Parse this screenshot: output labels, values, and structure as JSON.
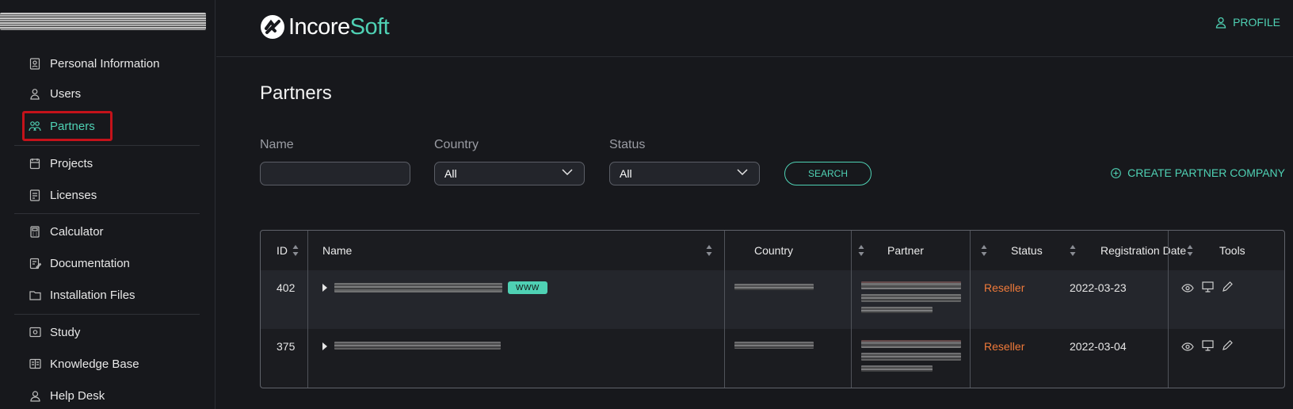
{
  "sidebar": {
    "items": [
      {
        "label": "Personal Information",
        "icon": "id-card-icon"
      },
      {
        "label": "Users",
        "icon": "user-icon"
      },
      {
        "label": "Partners",
        "icon": "partners-icon",
        "active": true
      },
      {
        "label": "Projects",
        "icon": "projects-icon"
      },
      {
        "label": "Licenses",
        "icon": "license-icon"
      },
      {
        "label": "Calculator",
        "icon": "calculator-icon"
      },
      {
        "label": "Documentation",
        "icon": "document-edit-icon"
      },
      {
        "label": "Installation Files",
        "icon": "folder-icon"
      },
      {
        "label": "Study",
        "icon": "study-icon"
      },
      {
        "label": "Knowledge Base",
        "icon": "book-icon"
      },
      {
        "label": "Help Desk",
        "icon": "help-desk-icon"
      }
    ]
  },
  "header": {
    "logo_part1": "Incore",
    "logo_part2": "Soft",
    "profile_label": "PROFILE"
  },
  "page": {
    "title": "Partners"
  },
  "filters": {
    "name_label": "Name",
    "name_value": "",
    "country_label": "Country",
    "country_value": "All",
    "status_label": "Status",
    "status_value": "All",
    "search_label": "SEARCH",
    "create_label": "CREATE PARTNER COMPANY"
  },
  "table": {
    "columns": [
      "ID",
      "Name",
      "Country",
      "Partner",
      "Status",
      "Registration Date",
      "Tools"
    ],
    "rows": [
      {
        "id": "402",
        "badge": "WWW",
        "status": "Reseller",
        "date": "2022-03-23"
      },
      {
        "id": "375",
        "badge": "",
        "status": "Reseller",
        "date": "2022-03-04"
      }
    ]
  },
  "colors": {
    "accent": "#4fd1b4",
    "status_reseller": "#f07a3a",
    "highlight": "#c4121a",
    "background": "#17181c"
  }
}
